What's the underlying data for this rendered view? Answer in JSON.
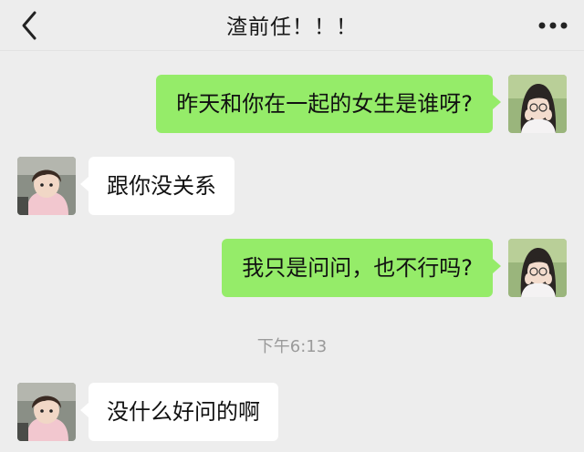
{
  "header": {
    "title": "渣前任！！！",
    "back_icon": "chevron-left-icon",
    "more_icon": "more-dots-icon"
  },
  "messages": [
    {
      "side": "right",
      "text": "昨天和你在一起的女生是谁呀?"
    },
    {
      "side": "left",
      "text": "跟你没关系"
    },
    {
      "side": "right",
      "text": "我只是问问，也不行吗?"
    },
    {
      "side": "left",
      "text": "没什么好问的啊"
    }
  ],
  "timestamp": "下午6:13",
  "colors": {
    "background": "#ededed",
    "sent_bubble": "#95ec69",
    "received_bubble": "#ffffff",
    "timestamp_text": "#9a9a9a"
  }
}
